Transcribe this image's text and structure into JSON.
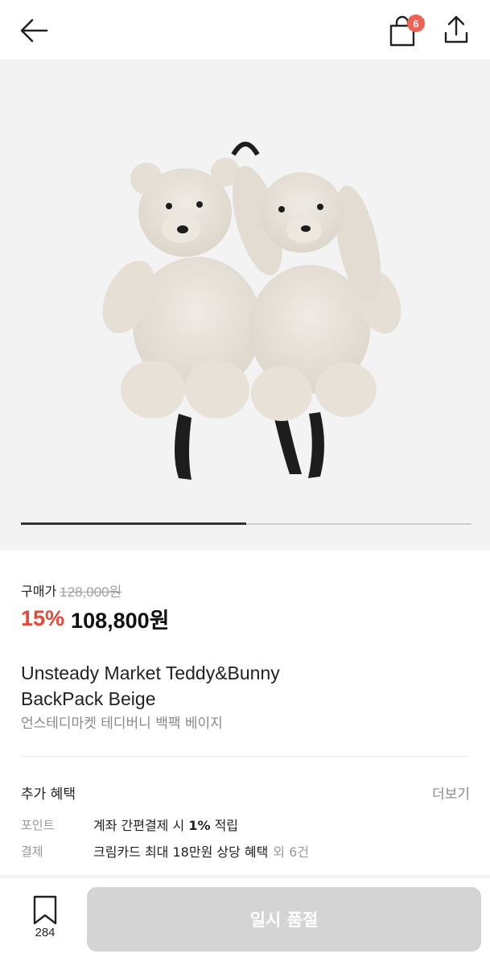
{
  "header": {
    "back_icon": "arrow-left-icon",
    "cart_icon": "shopping-bag-icon",
    "cart_count": "6",
    "share_icon": "share-upload-icon"
  },
  "gallery": {
    "image_description_icon": "teddy-bunny-backpack-image",
    "progress_fraction": 0.5
  },
  "price": {
    "label": "구매가",
    "original": "128,000원",
    "discount": "15%",
    "sale": "108,800원"
  },
  "product": {
    "title_en_line1": "Unsteady Market Teddy&Bunny",
    "title_en_line2": "BackPack Beige",
    "title_ko": "언스테디마켓 테디버니 백팩 베이지"
  },
  "benefits": {
    "title": "추가 혜택",
    "more": "더보기",
    "rows": [
      {
        "key": "포인트",
        "text_before": "계좌 간편결제 시 ",
        "highlight": "1%",
        "text_after": " 적립",
        "extra": ""
      },
      {
        "key": "결제",
        "text_before": "크림카드 최대 18만원 상당 혜택",
        "highlight": "",
        "text_after": "",
        "extra": "외 6건"
      }
    ]
  },
  "bottom_bar": {
    "wish_icon": "bookmark-icon",
    "wish_count": "284",
    "cta_label": "일시 품절"
  },
  "colors": {
    "accent_discount": "#e5483a",
    "badge": "#ef6253",
    "cta_disabled": "#d4d4d4"
  }
}
